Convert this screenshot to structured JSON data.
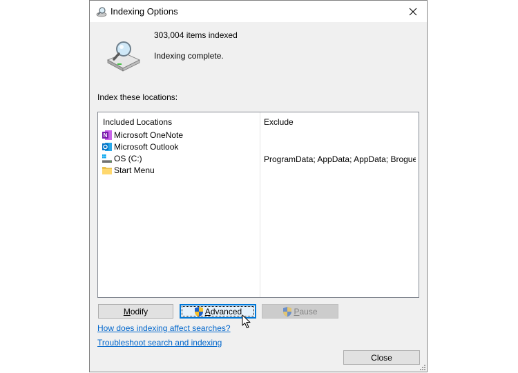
{
  "window": {
    "title": "Indexing Options",
    "icon": "indexing-magnifier-icon"
  },
  "summary": {
    "items_indexed": "303,004 items indexed",
    "status": "Indexing complete."
  },
  "locations": {
    "section_label": "Index these locations:",
    "columns": {
      "included": "Included Locations",
      "exclude": "Exclude"
    },
    "rows": [
      {
        "name": "Microsoft OneNote",
        "exclude": "",
        "icon": "onenote-icon"
      },
      {
        "name": "Microsoft Outlook",
        "exclude": "",
        "icon": "outlook-icon"
      },
      {
        "name": "OS (C:)",
        "exclude": "ProgramData; AppData; AppData; Brogue...",
        "icon": "drive-icon"
      },
      {
        "name": "Start Menu",
        "exclude": "",
        "icon": "folder-icon"
      }
    ]
  },
  "buttons": {
    "modify": {
      "pre": "",
      "accel": "M",
      "post": "odify"
    },
    "advanced": {
      "pre": "",
      "accel": "A",
      "post": "dvanced"
    },
    "pause": {
      "pre": "",
      "accel": "P",
      "post": "ause"
    },
    "close": "Close"
  },
  "links": {
    "how_indexing": "How does indexing affect searches?",
    "troubleshoot": "Troubleshoot search and indexing"
  },
  "colors": {
    "link": "#0066cc",
    "focus": "#0078d7",
    "onenote": "#7719aa",
    "outlook": "#0072c6"
  }
}
